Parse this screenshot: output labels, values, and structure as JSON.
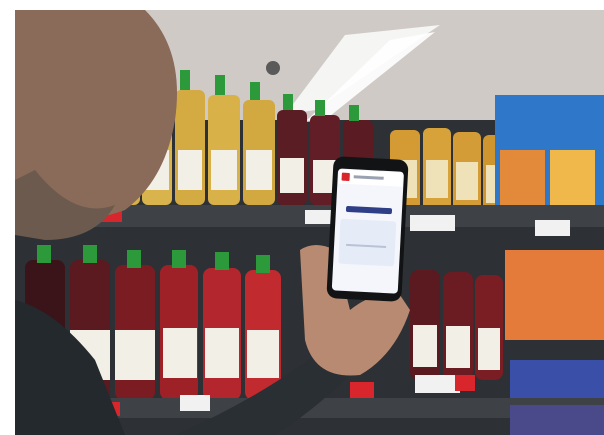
{
  "scene": {
    "phone": {
      "app_title": "",
      "status_time": ""
    }
  },
  "colors": {
    "shelf_background": "#2b2f33",
    "bottle_green_cap": "#2c9a3a",
    "apple_juice": "#d4a43a",
    "red_juice": "#b3262e",
    "dark_juice": "#4a1a1f",
    "price_label_red": "#d8262c",
    "product_box_blue": "#2f77c8",
    "ceiling_light": "#f4f4f4"
  }
}
